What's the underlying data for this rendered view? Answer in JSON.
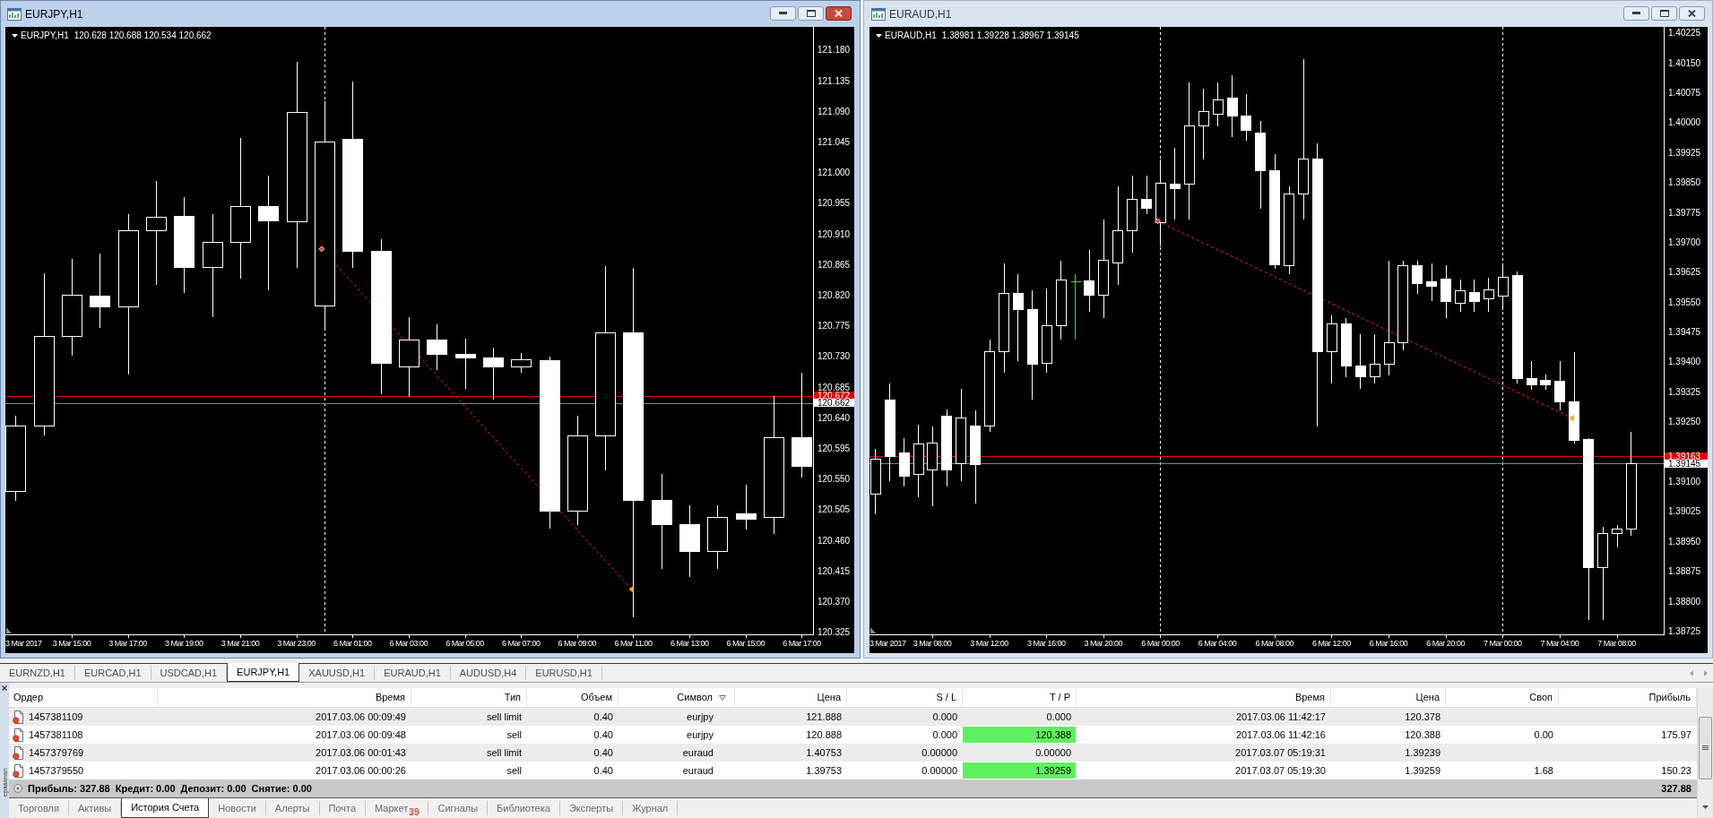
{
  "charts": [
    {
      "title": "EURJPY,H1",
      "active": true,
      "symbol": "EURJPY,H1",
      "ohlc": "120.628 120.688 120.534 120.662",
      "axis_start_label": "3 Mar 2017",
      "chart_data": {
        "type": "candlestick",
        "categories": [
          null,
          null,
          "3 Mar 15:00",
          null,
          "3 Mar 17:00",
          null,
          "3 Mar 19:00",
          null,
          "3 Mar 21:00",
          null,
          "3 Mar 23:00",
          null,
          "6 Mar 01:00",
          null,
          "6 Mar 03:00",
          null,
          "6 Mar 05:00",
          null,
          "6 Mar 07:00",
          null,
          "6 Mar 09:00",
          null,
          "6 Mar 11:00",
          null,
          "6 Mar 13:00",
          null,
          "6 Mar 15:00",
          null,
          "6 Mar 17:00"
        ],
        "ohlc": [
          [
            120.532,
            120.644,
            120.519,
            120.628
          ],
          [
            120.628,
            120.853,
            120.615,
            120.76
          ],
          [
            120.76,
            120.874,
            120.732,
            120.821
          ],
          [
            120.819,
            120.882,
            120.773,
            120.803
          ],
          [
            120.803,
            120.941,
            120.705,
            120.915
          ],
          [
            120.915,
            120.989,
            120.837,
            120.935
          ],
          [
            120.936,
            120.965,
            120.824,
            120.862
          ],
          [
            120.861,
            120.941,
            120.789,
            120.898
          ],
          [
            120.898,
            121.052,
            120.845,
            120.951
          ],
          [
            120.951,
            120.997,
            120.829,
            120.93
          ],
          [
            120.928,
            121.164,
            120.861,
            121.089
          ],
          [
            120.805,
            121.106,
            120.773,
            121.045
          ],
          [
            121.05,
            121.135,
            120.861,
            120.885
          ],
          [
            120.885,
            120.904,
            120.676,
            120.72
          ],
          [
            120.715,
            120.789,
            120.672,
            120.755
          ],
          [
            120.755,
            120.779,
            120.712,
            120.734
          ],
          [
            120.734,
            120.757,
            120.684,
            120.729
          ],
          [
            120.729,
            120.744,
            120.668,
            120.715
          ],
          [
            120.715,
            120.737,
            120.708,
            120.726
          ],
          [
            120.724,
            120.731,
            120.479,
            120.503
          ],
          [
            120.503,
            120.644,
            120.484,
            120.614
          ],
          [
            120.614,
            120.864,
            120.564,
            120.765
          ],
          [
            120.765,
            120.861,
            120.348,
            120.519
          ],
          [
            120.519,
            120.559,
            120.42,
            120.484
          ],
          [
            120.484,
            120.513,
            120.407,
            120.444
          ],
          [
            120.444,
            120.513,
            120.42,
            120.495
          ],
          [
            120.5,
            120.543,
            120.477,
            120.492
          ],
          [
            120.495,
            120.673,
            120.471,
            120.611
          ],
          [
            120.611,
            120.708,
            120.553,
            120.569
          ]
        ],
        "ylim": [
          120.322,
          121.214
        ],
        "yticks": [
          {
            "value": 121.18,
            "label": "121.180"
          },
          {
            "value": 121.135,
            "label": "121.135"
          },
          {
            "value": 121.09,
            "label": "121.090"
          },
          {
            "value": 121.045,
            "label": "121.045"
          },
          {
            "value": 121.0,
            "label": "121.000"
          },
          {
            "value": 120.955,
            "label": "120.955"
          },
          {
            "value": 120.91,
            "label": "120.910"
          },
          {
            "value": 120.865,
            "label": "120.865"
          },
          {
            "value": 120.82,
            "label": "120.820"
          },
          {
            "value": 120.775,
            "label": "120.775"
          },
          {
            "value": 120.73,
            "label": "120.730"
          },
          {
            "value": 120.685,
            "label": "120.685"
          },
          {
            "value": 120.64,
            "label": "120.640"
          },
          {
            "value": 120.595,
            "label": "120.595"
          },
          {
            "value": 120.55,
            "label": "120.550"
          },
          {
            "value": 120.505,
            "label": "120.505"
          },
          {
            "value": 120.46,
            "label": "120.460"
          },
          {
            "value": 120.415,
            "label": "120.415"
          },
          {
            "value": 120.37,
            "label": "120.370"
          },
          {
            "value": 120.325,
            "label": "120.325"
          }
        ],
        "ref_lines": [
          {
            "axis": "y",
            "value": 120.672,
            "label": "120.672",
            "color": "#e00000"
          },
          {
            "axis": "y",
            "value": 120.662,
            "label": "120.662",
            "color": "#778899"
          }
        ]
      }
    },
    {
      "title": "EURAUD,H1",
      "active": false,
      "symbol": "EURAUD,H1",
      "ohlc": "1.38981 1.39228 1.38967 1.39145",
      "axis_start_label": "3 Mar 2017",
      "chart_data": {
        "type": "candlestick",
        "categories": [
          null,
          null,
          null,
          null,
          "3 Mar 08:00",
          null,
          null,
          null,
          "3 Mar 12:00",
          null,
          null,
          null,
          "3 Mar 16:00",
          null,
          null,
          null,
          "3 Mar 20:00",
          null,
          null,
          null,
          "6 Mar 00:00",
          null,
          null,
          null,
          "6 Mar 04:00",
          null,
          null,
          null,
          "6 Mar 08:00",
          null,
          null,
          null,
          "6 Mar 12:00",
          null,
          null,
          null,
          "6 Mar 16:00",
          null,
          null,
          null,
          "6 Mar 20:00",
          null,
          null,
          null,
          "7 Mar 00:00",
          null,
          null,
          null,
          "7 Mar 04:00",
          null,
          null,
          null,
          "7 Mar 08:00",
          null
        ],
        "ohlc": [
          [
            1.3907,
            1.39185,
            1.3902,
            1.39157
          ],
          [
            1.39305,
            1.39349,
            1.39103,
            1.39163
          ],
          [
            1.39174,
            1.39212,
            1.39089,
            1.39114
          ],
          [
            1.39119,
            1.39245,
            1.39062,
            1.39196
          ],
          [
            1.3913,
            1.3924,
            1.3904,
            1.39198
          ],
          [
            1.39264,
            1.39283,
            1.39089,
            1.3913
          ],
          [
            1.39146,
            1.39335,
            1.39103,
            1.39261
          ],
          [
            1.3924,
            1.39281,
            1.39048,
            1.39144
          ],
          [
            1.3924,
            1.39459,
            1.39226,
            1.39426
          ],
          [
            1.39426,
            1.3965,
            1.39376,
            1.39573
          ],
          [
            1.39573,
            1.39623,
            1.39404,
            1.39532
          ],
          [
            1.39532,
            1.39582,
            1.39308,
            1.39396
          ],
          [
            1.39398,
            1.39587,
            1.39376,
            1.39491
          ],
          [
            1.39491,
            1.39656,
            1.39459,
            1.39606
          ],
          [
            1.39601,
            1.39623,
            1.39459,
            1.39601
          ],
          [
            1.39604,
            1.39683,
            1.39527,
            1.39568
          ],
          [
            1.39568,
            1.3976,
            1.39513,
            1.39656
          ],
          [
            1.3965,
            1.39842,
            1.39595,
            1.3973
          ],
          [
            1.3973,
            1.39869,
            1.39677,
            1.39809
          ],
          [
            1.39809,
            1.39869,
            1.39773,
            1.39787
          ],
          [
            1.39751,
            1.3991,
            1.39691,
            1.3985
          ],
          [
            1.39847,
            1.39938,
            1.3976,
            1.39836
          ],
          [
            1.39847,
            1.40102,
            1.3976,
            1.39992
          ],
          [
            1.39992,
            1.40088,
            1.3991,
            1.40028
          ],
          [
            1.40022,
            1.40102,
            1.39992,
            1.40058
          ],
          [
            1.40063,
            1.40121,
            1.39965,
            1.40017
          ],
          [
            1.40017,
            1.40074,
            1.39957,
            1.39981
          ],
          [
            1.39976,
            1.40006,
            1.39787,
            1.3988
          ],
          [
            1.3988,
            1.39924,
            1.39636,
            1.39645
          ],
          [
            1.39642,
            1.39842,
            1.39623,
            1.39823
          ],
          [
            1.39823,
            1.40162,
            1.3976,
            1.3991
          ],
          [
            1.3991,
            1.39951,
            1.3924,
            1.39426
          ],
          [
            1.39426,
            1.39519,
            1.39349,
            1.39497
          ],
          [
            1.39497,
            1.39513,
            1.39363,
            1.3939
          ],
          [
            1.3939,
            1.39472,
            1.39335,
            1.39363
          ],
          [
            1.39363,
            1.39472,
            1.39349,
            1.39396
          ],
          [
            1.39396,
            1.39656,
            1.39368,
            1.3945
          ],
          [
            1.3945,
            1.39656,
            1.39431,
            1.39642
          ],
          [
            1.39642,
            1.39656,
            1.39573,
            1.39598
          ],
          [
            1.39601,
            1.3965,
            1.39554,
            1.3959
          ],
          [
            1.39609,
            1.39645,
            1.39513,
            1.39552
          ],
          [
            1.39549,
            1.39609,
            1.39527,
            1.39579
          ],
          [
            1.39576,
            1.39609,
            1.39527,
            1.39552
          ],
          [
            1.3956,
            1.39614,
            1.39527,
            1.39582
          ],
          [
            1.39565,
            1.3965,
            1.39532,
            1.39614
          ],
          [
            1.39617,
            1.39628,
            1.39349,
            1.3936
          ],
          [
            1.3936,
            1.39404,
            1.39333,
            1.39344
          ],
          [
            1.39354,
            1.39371,
            1.39333,
            1.39344
          ],
          [
            1.39352,
            1.39404,
            1.39281,
            1.393
          ],
          [
            1.39302,
            1.39426,
            1.39198,
            1.39204
          ],
          [
            1.39207,
            1.39212,
            1.38755,
            1.38886
          ],
          [
            1.38886,
            1.38988,
            1.38755,
            1.38971
          ],
          [
            1.38971,
            1.38993,
            1.38938,
            1.38982
          ],
          [
            1.38981,
            1.39228,
            1.38967,
            1.39145
          ]
        ],
        "ylim": [
          1.38717,
          1.4024
        ],
        "yticks": [
          {
            "value": 1.40225,
            "label": "1.40225"
          },
          {
            "value": 1.4015,
            "label": "1.40150"
          },
          {
            "value": 1.40075,
            "label": "1.40075"
          },
          {
            "value": 1.4,
            "label": "1.40000"
          },
          {
            "value": 1.39925,
            "label": "1.39925"
          },
          {
            "value": 1.3985,
            "label": "1.39850"
          },
          {
            "value": 1.39775,
            "label": "1.39775"
          },
          {
            "value": 1.397,
            "label": "1.39700"
          },
          {
            "value": 1.39625,
            "label": "1.39625"
          },
          {
            "value": 1.3955,
            "label": "1.39550"
          },
          {
            "value": 1.39475,
            "label": "1.39475"
          },
          {
            "value": 1.394,
            "label": "1.39400"
          },
          {
            "value": 1.39325,
            "label": "1.39325"
          },
          {
            "value": 1.3925,
            "label": "1.39250"
          },
          {
            "value": 1.391,
            "label": "1.39100"
          },
          {
            "value": 1.39025,
            "label": "1.39025"
          },
          {
            "value": 1.3895,
            "label": "1.38950"
          },
          {
            "value": 1.38875,
            "label": "1.38875"
          },
          {
            "value": 1.388,
            "label": "1.38800"
          },
          {
            "value": 1.38725,
            "label": "1.38725"
          }
        ],
        "ref_lines": [
          {
            "axis": "y",
            "value": 1.39163,
            "label": "1.39163",
            "color": "#e00000"
          },
          {
            "axis": "y",
            "value": 1.39145,
            "label": "1.39145",
            "color": "#778899"
          }
        ]
      }
    }
  ],
  "chart_tabs": [
    {
      "label": "EURNZD,H1",
      "selected": false
    },
    {
      "label": "EURCAD,H1",
      "selected": false
    },
    {
      "label": "USDCAD,H1",
      "selected": false
    },
    {
      "label": "EURJPY,H1",
      "selected": true
    },
    {
      "label": "XAUUSD,H1",
      "selected": false
    },
    {
      "label": "EURAUD,H1",
      "selected": false
    },
    {
      "label": "AUDUSD,H4",
      "selected": false
    },
    {
      "label": "EURUSD,H1",
      "selected": false
    }
  ],
  "terminal": {
    "side_title": "ерминал",
    "columns": [
      {
        "label": "Ордер",
        "sorted": false
      },
      {
        "label": "Время",
        "sorted": false
      },
      {
        "label": "Тип",
        "sorted": false
      },
      {
        "label": "Объем",
        "sorted": false
      },
      {
        "label": "Символ",
        "sorted": true
      },
      {
        "label": "Цена",
        "sorted": false
      },
      {
        "label": "S / L",
        "sorted": false
      },
      {
        "label": "T / P",
        "sorted": false
      },
      {
        "label": "Время",
        "sorted": false
      },
      {
        "label": "Цена",
        "sorted": false
      },
      {
        "label": "Своп",
        "sorted": false
      },
      {
        "label": "Прибыль",
        "sorted": false
      }
    ],
    "orders": [
      {
        "order": "1457381109",
        "open_time": "2017.03.06 00:09:49",
        "type": "sell limit",
        "volume": "0.40",
        "symbol": "eurjpy",
        "open_price": "121.888",
        "sl": "0.000",
        "tp": "0.000",
        "tp_hit": false,
        "close_time": "2017.03.06 11:42:17",
        "close_price": "120.378"
      },
      {
        "order": "1457381108",
        "open_time": "2017.03.06 00:09:48",
        "type": "sell",
        "volume": "0.40",
        "symbol": "eurjpy",
        "open_price": "120.888",
        "sl": "0.000",
        "tp": "120.388",
        "tp_hit": true,
        "close_time": "2017.03.06 11:42:16",
        "close_price": "120.388",
        "swap": "0.00",
        "profit": "175.97"
      },
      {
        "order": "1457379769",
        "open_time": "2017.03.06 00:01:43",
        "type": "sell limit",
        "volume": "0.40",
        "symbol": "euraud",
        "open_price": "1.40753",
        "sl": "0.00000",
        "tp": "0.00000",
        "tp_hit": false,
        "close_time": "2017.03.07 05:19:31",
        "close_price": "1.39239"
      },
      {
        "order": "1457379550",
        "open_time": "2017.03.06 00:00:26",
        "type": "sell",
        "volume": "0.40",
        "symbol": "euraud",
        "open_price": "1.39753",
        "sl": "0.00000",
        "tp": "1.39259",
        "tp_hit": true,
        "close_time": "2017.03.07 05:19:30",
        "close_price": "1.39259",
        "swap": "1.68",
        "profit": "150.23"
      }
    ],
    "summary": [
      "Прибыль: 327.88",
      "Кредит: 0.00",
      "Депозит: 0.00",
      "Снятие: 0.00"
    ],
    "total_profit": "327.88",
    "tabs": [
      {
        "label": "Торговля",
        "selected": false
      },
      {
        "label": "Активы",
        "selected": false
      },
      {
        "label": "История Счета",
        "selected": true
      },
      {
        "label": "Новости",
        "selected": false
      },
      {
        "label": "Алерты",
        "selected": false
      },
      {
        "label": "Почта",
        "selected": false
      },
      {
        "label": "Маркет",
        "badge": "39",
        "selected": false
      },
      {
        "label": "Сигналы",
        "selected": false
      },
      {
        "label": "Библиотека",
        "selected": false
      },
      {
        "label": "Эксперты",
        "selected": false
      },
      {
        "label": "Журнал",
        "selected": false
      }
    ]
  }
}
